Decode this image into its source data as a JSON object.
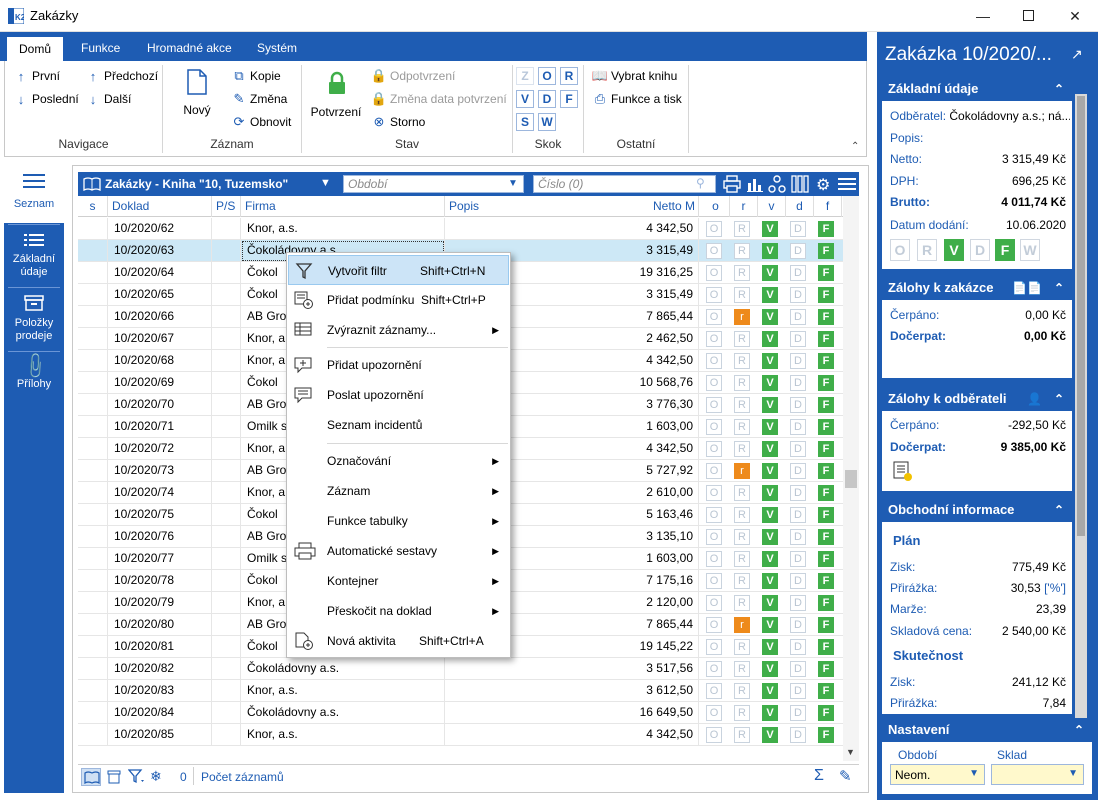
{
  "window": {
    "title": "Zakázky"
  },
  "ribbon": {
    "tabs": [
      "Domů",
      "Funkce",
      "Hromadné akce",
      "Systém"
    ],
    "groups": {
      "navigace": {
        "label": "Navigace",
        "first": "První",
        "prev": "Předchozí",
        "last": "Poslední",
        "next": "Další"
      },
      "zaznam": {
        "label": "Záznam",
        "new": "Nový",
        "copy": "Kopie",
        "change": "Změna",
        "refresh": "Obnovit"
      },
      "stav": {
        "label": "Stav",
        "confirm": "Potvrzení",
        "unconfirm": "Odpotvrzení",
        "change_date": "Změna data potvrzení",
        "storno": "Storno"
      },
      "skok": {
        "label": "Skok",
        "letters": [
          "Z",
          "O",
          "R",
          "V",
          "D",
          "F",
          "S",
          "W"
        ]
      },
      "ostatni": {
        "label": "Ostatní",
        "book": "Vybrat knihu",
        "print_fn": "Funkce a tisk"
      }
    }
  },
  "leftnav": {
    "items": [
      {
        "label": "Seznam"
      },
      {
        "label": "Základní údaje"
      },
      {
        "label": "Položky prodeje"
      },
      {
        "label": "Přílohy"
      }
    ]
  },
  "grid": {
    "title": "Zakázky - Kniha \"10, Tuzemsko\"",
    "period_placeholder": "Období",
    "number_placeholder": "Číslo (0)",
    "columns": [
      "s",
      "Doklad",
      "P/S",
      "Firma",
      "Popis",
      "Netto M",
      "o",
      "r",
      "v",
      "d",
      "f"
    ],
    "rows": [
      {
        "doklad": "10/2020/62",
        "firma": "Knor, a.s.",
        "netto": "4 342,50",
        "r": false
      },
      {
        "doklad": "10/2020/63",
        "firma": "Čokoládovny a.s.",
        "netto": "3 315,49",
        "r": false
      },
      {
        "doklad": "10/2020/64",
        "firma": "Čokol",
        "netto": "19 316,25",
        "r": false
      },
      {
        "doklad": "10/2020/65",
        "firma": "Čokol",
        "netto": "3 315,49",
        "r": false
      },
      {
        "doklad": "10/2020/66",
        "firma": "AB Gro",
        "netto": "7 865,44",
        "r": true
      },
      {
        "doklad": "10/2020/67",
        "firma": "Knor, a",
        "netto": "2 462,50",
        "r": false
      },
      {
        "doklad": "10/2020/68",
        "firma": "Knor, a",
        "netto": "4 342,50",
        "r": false
      },
      {
        "doklad": "10/2020/69",
        "firma": "Čokol",
        "netto": "10 568,76",
        "r": false
      },
      {
        "doklad": "10/2020/70",
        "firma": "AB Gro",
        "netto": "3 776,30",
        "r": false
      },
      {
        "doklad": "10/2020/71",
        "firma": "Omilk s",
        "netto": "1 603,00",
        "r": false
      },
      {
        "doklad": "10/2020/72",
        "firma": "Knor, a",
        "netto": "4 342,50",
        "r": false
      },
      {
        "doklad": "10/2020/73",
        "firma": "AB Gro",
        "netto": "5 727,92",
        "r": true
      },
      {
        "doklad": "10/2020/74",
        "firma": "Knor, a",
        "netto": "2 610,00",
        "r": false
      },
      {
        "doklad": "10/2020/75",
        "firma": "Čokol",
        "netto": "5 163,46",
        "r": false
      },
      {
        "doklad": "10/2020/76",
        "firma": "AB Gro",
        "netto": "3 135,10",
        "r": false
      },
      {
        "doklad": "10/2020/77",
        "firma": "Omilk s",
        "netto": "1 603,00",
        "r": false
      },
      {
        "doklad": "10/2020/78",
        "firma": "Čokol",
        "netto": "7 175,16",
        "r": false
      },
      {
        "doklad": "10/2020/79",
        "firma": "Knor, a",
        "netto": "2 120,00",
        "r": false
      },
      {
        "doklad": "10/2020/80",
        "firma": "AB Gro",
        "netto": "7 865,44",
        "r": true
      },
      {
        "doklad": "10/2020/81",
        "firma": "Čokol",
        "netto": "19 145,22",
        "r": false
      },
      {
        "doklad": "10/2020/82",
        "firma": "Čokoládovny a.s.",
        "netto": "3 517,56",
        "r": false
      },
      {
        "doklad": "10/2020/83",
        "firma": "Knor, a.s.",
        "netto": "3 612,50",
        "r": false
      },
      {
        "doklad": "10/2020/84",
        "firma": "Čokoládovny a.s.",
        "netto": "16 649,50",
        "r": false
      },
      {
        "doklad": "10/2020/85",
        "firma": "Knor, a.s.",
        "netto": "4 342,50",
        "r": false
      }
    ],
    "flags": {
      "o": "O",
      "r": "R",
      "r_active": "r",
      "v": "V",
      "d": "D",
      "f": "F"
    },
    "footer": {
      "count": "0",
      "record_count": "Počet záznamů"
    }
  },
  "context_menu": {
    "items": [
      {
        "label": "Vytvořit filtr",
        "shortcut": "Shift+Ctrl+N",
        "icon": "filter-icon"
      },
      {
        "label": "Přidat podmínku",
        "shortcut": "Shift+Ctrl+P",
        "icon": "add-condition-icon"
      },
      {
        "label": "Zvýraznit záznamy...",
        "icon": "highlight-icon"
      },
      {
        "label": "Přidat upozornění",
        "icon": "add-notice-icon"
      },
      {
        "label": "Poslat upozornění",
        "icon": "send-notice-icon"
      },
      {
        "label": "Seznam incidentů"
      },
      {
        "label": "Označování"
      },
      {
        "label": "Záznam"
      },
      {
        "label": "Funkce tabulky"
      },
      {
        "label": "Automatické sestavy",
        "icon": "printer-icon"
      },
      {
        "label": "Kontejner"
      },
      {
        "label": "Přeskočit na doklad"
      },
      {
        "label": "Nová aktivita",
        "shortcut": "Shift+Ctrl+A",
        "icon": "new-activity-icon"
      }
    ]
  },
  "right_panel": {
    "title": "Zakázka 10/2020/...",
    "basic": {
      "header": "Základní údaje",
      "odberatel_label": "Odběratel:",
      "odberatel_value": "Čokoládovny a.s.; ná...",
      "popis_label": "Popis:",
      "netto_label": "Netto:",
      "netto_value": "3 315,49 Kč",
      "dph_label": "DPH:",
      "dph_value": "696,25 Kč",
      "brutto_label": "Brutto:",
      "brutto_value": "4 011,74 Kč",
      "datum_label": "Datum dodání:",
      "datum_value": "10.06.2020",
      "status_letters": [
        "O",
        "R",
        "V",
        "D",
        "F",
        "W"
      ]
    },
    "zalohy_zakazka": {
      "header": "Zálohy k zakázce",
      "cerpano_label": "Čerpáno:",
      "cerpano_value": "0,00 Kč",
      "docerpat_label": "Dočerpat:",
      "docerpat_value": "0,00 Kč"
    },
    "zalohy_odberatel": {
      "header": "Zálohy k odběrateli",
      "cerpano_label": "Čerpáno:",
      "cerpano_value": "-292,50 Kč",
      "docerpat_label": "Dočerpat:",
      "docerpat_value": "9 385,00 Kč"
    },
    "obchodni": {
      "header": "Obchodní informace",
      "plan": "Plán",
      "zisk_label": "Zisk:",
      "zisk_value": "775,49 Kč",
      "prirazka_label": "Přirážka:",
      "prirazka_value": "30,53",
      "prirazka_unit": "['%']",
      "marze_label": "Marže:",
      "marze_value": "23,39",
      "sklad_label": "Skladová cena:",
      "sklad_value": "2 540,00 Kč",
      "skutecnost": "Skutečnost",
      "s_zisk_label": "Zisk:",
      "s_zisk_value": "241,12 Kč",
      "s_prirazka_label": "Přirážka:",
      "s_prirazka_value": "7,84"
    },
    "nastaveni": {
      "header": "Nastavení",
      "obdobi_label": "Období",
      "obdobi_value": "Neom.",
      "sklad_label": "Sklad",
      "sklad_value": ""
    }
  }
}
